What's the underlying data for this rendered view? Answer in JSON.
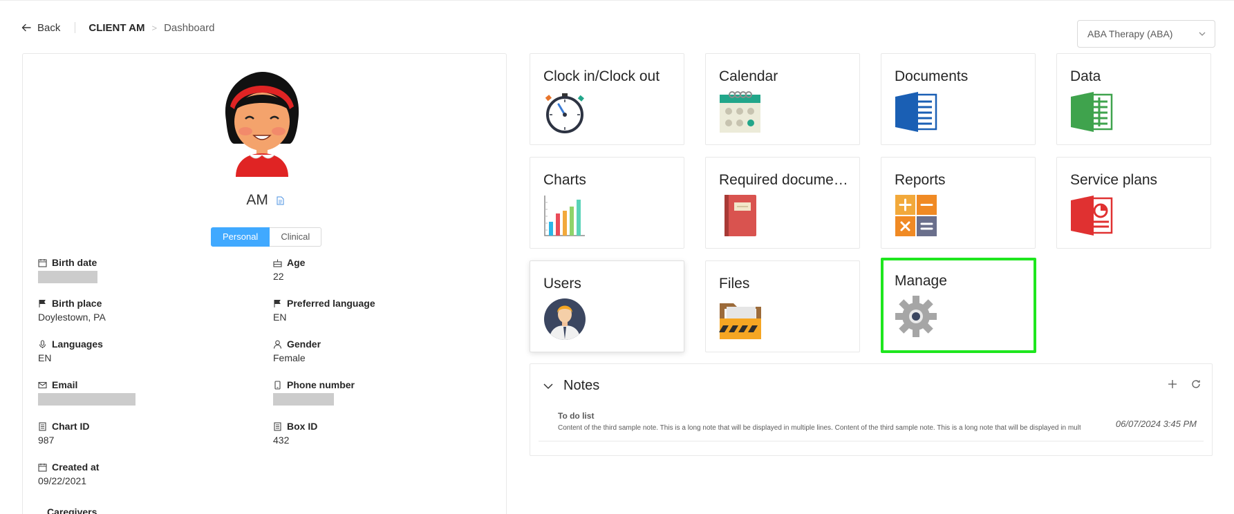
{
  "header": {
    "back_label": "Back",
    "client": "CLIENT AM",
    "page": "Dashboard",
    "separator": ">"
  },
  "program_select": {
    "value": "ABA Therapy (ABA)"
  },
  "profile": {
    "name": "AM",
    "tabs": [
      "Personal",
      "Clinical"
    ],
    "fields": {
      "birth_date": {
        "label": "Birth date",
        "value": ""
      },
      "age": {
        "label": "Age",
        "value": "22"
      },
      "birth_place": {
        "label": "Birth place",
        "value": "Doylestown, PA"
      },
      "preferred_language": {
        "label": "Preferred language",
        "value": "EN"
      },
      "languages": {
        "label": "Languages",
        "value": "EN"
      },
      "gender": {
        "label": "Gender",
        "value": "Female"
      },
      "email": {
        "label": "Email",
        "value": ""
      },
      "phone": {
        "label": "Phone number",
        "value": ""
      },
      "chart_id": {
        "label": "Chart ID",
        "value": "987"
      },
      "box_id": {
        "label": "Box ID",
        "value": "432"
      },
      "created_at": {
        "label": "Created at",
        "value": "09/22/2021"
      }
    },
    "caregivers_label": "Caregivers"
  },
  "tiles": {
    "clock": {
      "title": "Clock in/Clock out",
      "icon": "stopwatch-icon"
    },
    "calendar": {
      "title": "Calendar",
      "icon": "calendar-icon"
    },
    "documents": {
      "title": "Documents",
      "icon": "word-document-icon"
    },
    "data": {
      "title": "Data",
      "icon": "spreadsheet-icon"
    },
    "charts": {
      "title": "Charts",
      "icon": "bar-chart-icon"
    },
    "required": {
      "title": "Required documen...",
      "icon": "notebook-icon"
    },
    "reports": {
      "title": "Reports",
      "icon": "calculator-icon"
    },
    "service_plans": {
      "title": "Service plans",
      "icon": "presentation-icon"
    },
    "users": {
      "title": "Users",
      "icon": "user-avatar-icon"
    },
    "files": {
      "title": "Files",
      "icon": "folder-icon"
    },
    "manage": {
      "title": "Manage",
      "icon": "gear-icon"
    }
  },
  "notes": {
    "title": "Notes",
    "items": [
      {
        "title": "To do list",
        "body": "Content of the third sample note. This is a long note that will be displayed in multiple lines. Content of the third sample note. This is a long note that will be displayed in multiple lines.",
        "time": "06/07/2024 3:45 PM"
      }
    ]
  },
  "colors": {
    "accent": "#40a9ff",
    "highlight": "#1ee61e",
    "redaction": "#cccccc"
  }
}
